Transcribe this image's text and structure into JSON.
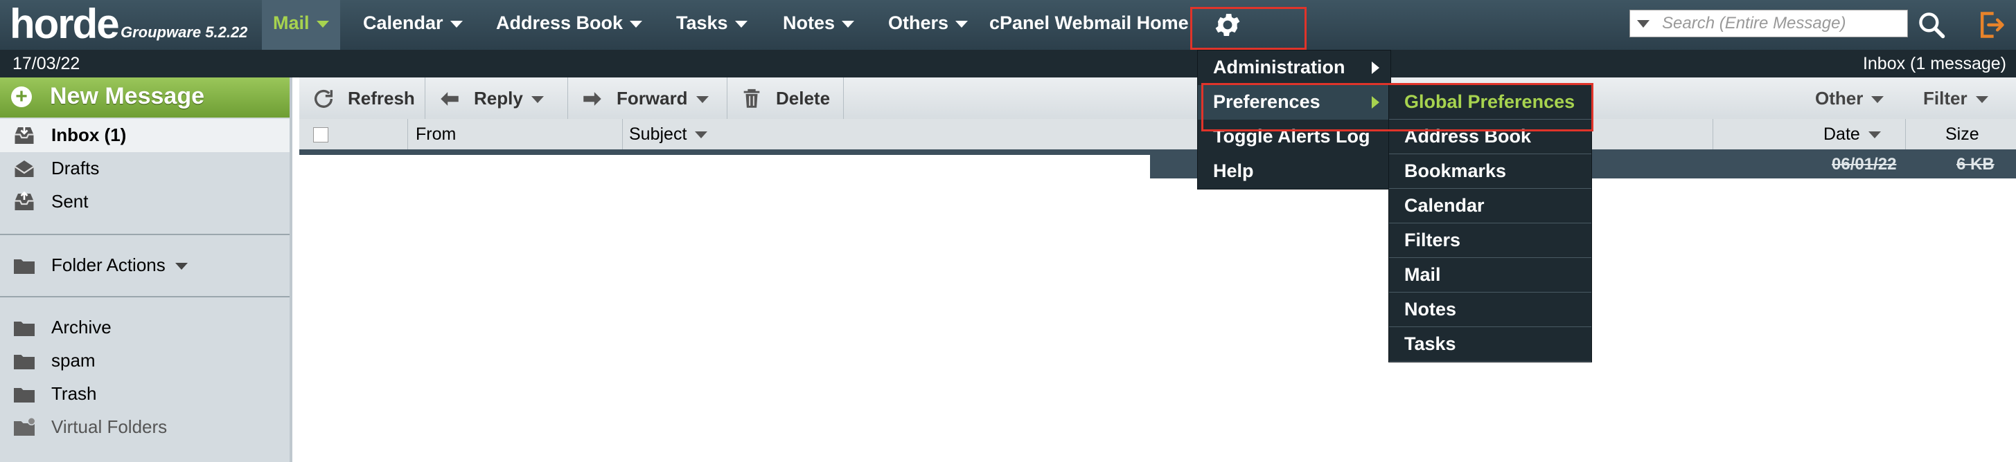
{
  "app": {
    "logo_text": "horde",
    "version": "Groupware 5.2.22"
  },
  "nav": {
    "mail": "Mail",
    "calendar": "Calendar",
    "address_book": "Address Book",
    "tasks": "Tasks",
    "notes": "Notes",
    "others": "Others",
    "cpanel": "cPanel Webmail Home"
  },
  "search": {
    "placeholder": "Search (Entire Message)"
  },
  "status_bar": {
    "date": "17/03/22",
    "inbox_status": "Inbox (1 message)"
  },
  "sidebar": {
    "new_message": "New Message",
    "folders": [
      {
        "label": "Inbox (1)",
        "icon": "inbox-icon"
      },
      {
        "label": "Drafts",
        "icon": "drafts-icon"
      },
      {
        "label": "Sent",
        "icon": "sent-icon"
      }
    ],
    "folder_actions": "Folder Actions",
    "other_folders": [
      {
        "label": "Archive",
        "icon": "folder-icon"
      },
      {
        "label": "spam",
        "icon": "folder-icon"
      },
      {
        "label": "Trash",
        "icon": "folder-icon"
      },
      {
        "label": "Virtual Folders",
        "icon": "virtual-folder-icon"
      }
    ]
  },
  "toolbar": {
    "refresh": "Refresh",
    "reply": "Reply",
    "forward": "Forward",
    "delete": "Delete",
    "other": "Other",
    "filter": "Filter"
  },
  "list": {
    "columns": {
      "from": "From",
      "subject": "Subject",
      "date": "Date",
      "size": "Size"
    },
    "rows": [
      {
        "date": "06/01/22",
        "size": "6 KB"
      }
    ]
  },
  "gear_menu": {
    "items": [
      "Administration",
      "Preferences",
      "Toggle Alerts Log",
      "Help"
    ]
  },
  "preferences_submenu": {
    "items": [
      "Global Preferences",
      "Address Book",
      "Bookmarks",
      "Calendar",
      "Filters",
      "Mail",
      "Notes",
      "Tasks"
    ]
  },
  "colors": {
    "accent_green": "#a7d34f",
    "highlight_red": "#e0342a",
    "topbar": "#34495a",
    "menu_bg": "#1e2a31"
  }
}
